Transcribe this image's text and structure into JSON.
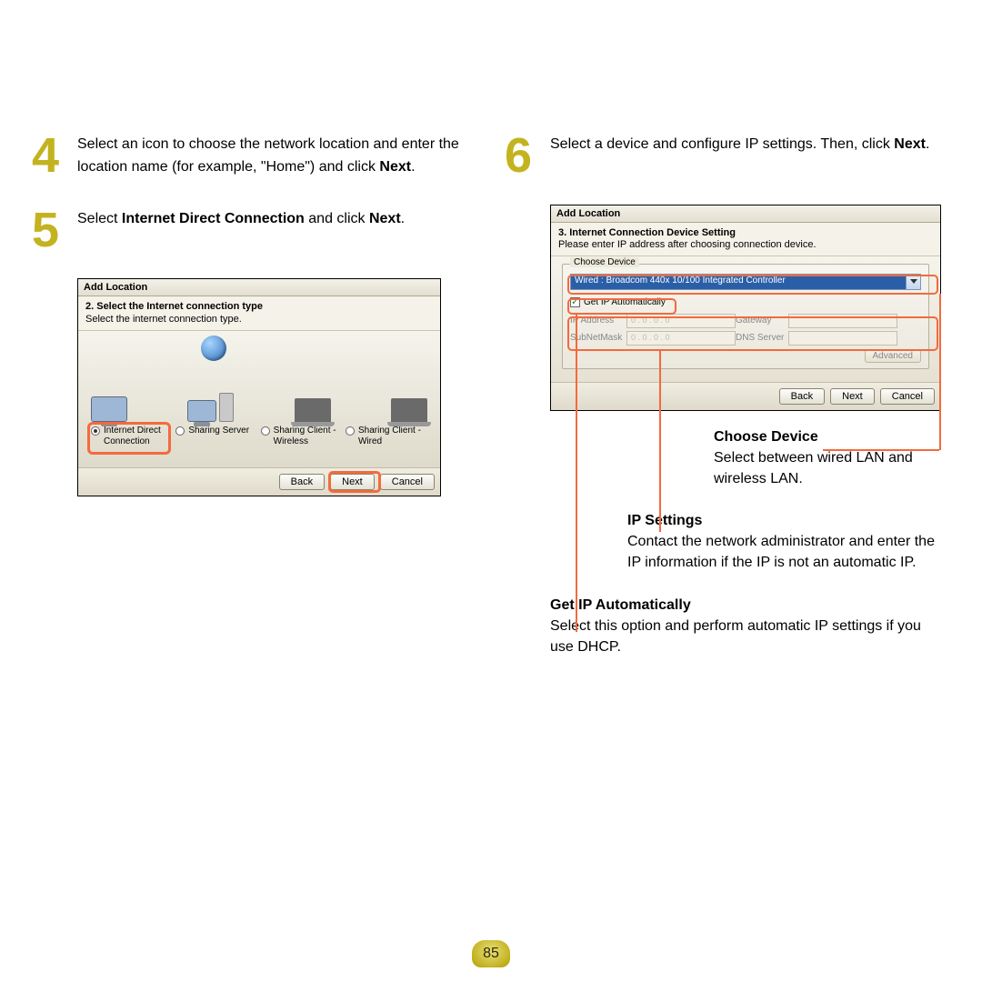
{
  "page_number": "85",
  "steps": {
    "s4": {
      "num": "4",
      "text_a": "Select an icon to choose the network location and enter the location name (for example, \"Home\") and click ",
      "bold": "Next",
      "text_b": "."
    },
    "s5": {
      "num": "5",
      "text_a": "Select ",
      "bold1": "Internet Direct Connection",
      "text_b": " and click ",
      "bold2": "Next",
      "text_c": "."
    },
    "s6": {
      "num": "6",
      "text_a": "Select a device and configure IP settings. Then, click ",
      "bold": "Next",
      "text_b": "."
    }
  },
  "shot1": {
    "title": "Add Location",
    "heading": "2. Select the Internet connection type",
    "desc": "Select the internet connection type.",
    "options": [
      "Internet Direct Connection",
      "Sharing Server",
      "Sharing Client - Wireless",
      "Sharing Client - Wired"
    ],
    "buttons": {
      "back": "Back",
      "next": "Next",
      "cancel": "Cancel"
    }
  },
  "shot2": {
    "title": "Add Location",
    "heading": "3. Internet Connection Device Setting",
    "desc": "Please enter IP address after choosing connection device.",
    "group_label": "Choose Device",
    "device": "Wired : Broadcom 440x 10/100 Integrated Controller",
    "get_ip": "Get IP Automatically",
    "fields": {
      "ip": "IP Address",
      "mask": "SubNetMask",
      "gw": "Gateway",
      "dns": "DNS Server",
      "placeholder": "0   .   0   .   0   .   0"
    },
    "advanced": "Advanced",
    "buttons": {
      "back": "Back",
      "next": "Next",
      "cancel": "Cancel"
    }
  },
  "annotations": {
    "choose_device": {
      "title": "Choose Device",
      "text": "Select between wired LAN and wireless LAN."
    },
    "ip_settings": {
      "title": "IP Settings",
      "text": "Contact the network administrator and enter the IP information if the IP is not an automatic IP."
    },
    "get_ip": {
      "title": "Get IP Automatically",
      "text": "Select this option and perform automatic IP settings if you use DHCP."
    }
  }
}
